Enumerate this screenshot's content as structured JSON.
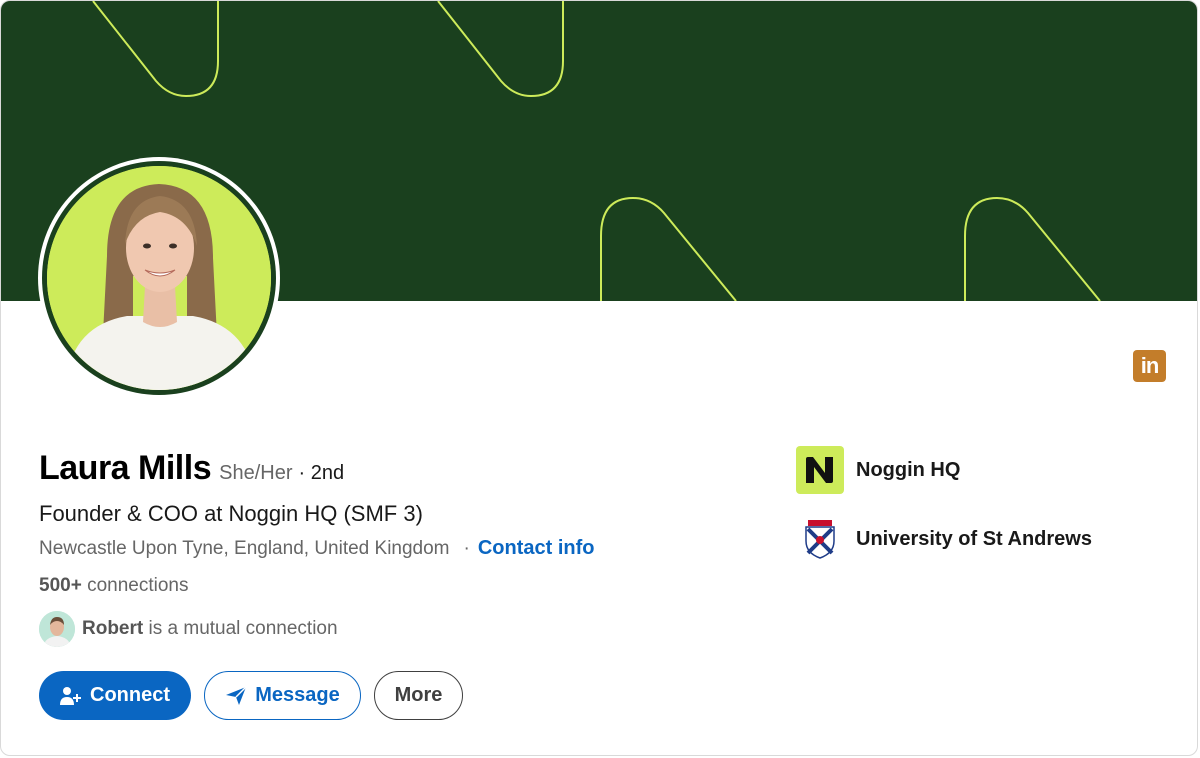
{
  "profile": {
    "name": "Laura Mills",
    "pronouns": "She/Her",
    "degree": "· 2nd",
    "headline": "Founder & COO at Noggin HQ (SMF 3)",
    "location": "Newcastle Upon Tyne, England, United Kingdom",
    "location_separator": "·",
    "contact_info_label": "Contact info",
    "connections_count": "500+",
    "connections_label": "connections",
    "mutual_name": "Robert",
    "mutual_text": "is a mutual connection"
  },
  "actions": {
    "connect_label": "Connect",
    "message_label": "Message",
    "more_label": "More"
  },
  "sidebar": {
    "items": [
      {
        "label": "Noggin HQ",
        "icon": "noggin-logo-icon"
      },
      {
        "label": "University of St Andrews",
        "icon": "university-crest-icon"
      }
    ]
  },
  "badge": {
    "label": "in",
    "icon": "linkedin-icon"
  },
  "colors": {
    "banner": "#1a401e",
    "banner_lines": "#cdeb5a",
    "accent": "#0a66c2",
    "avatar_bg": "#cdeb5a",
    "badge": "#c37d2a"
  }
}
